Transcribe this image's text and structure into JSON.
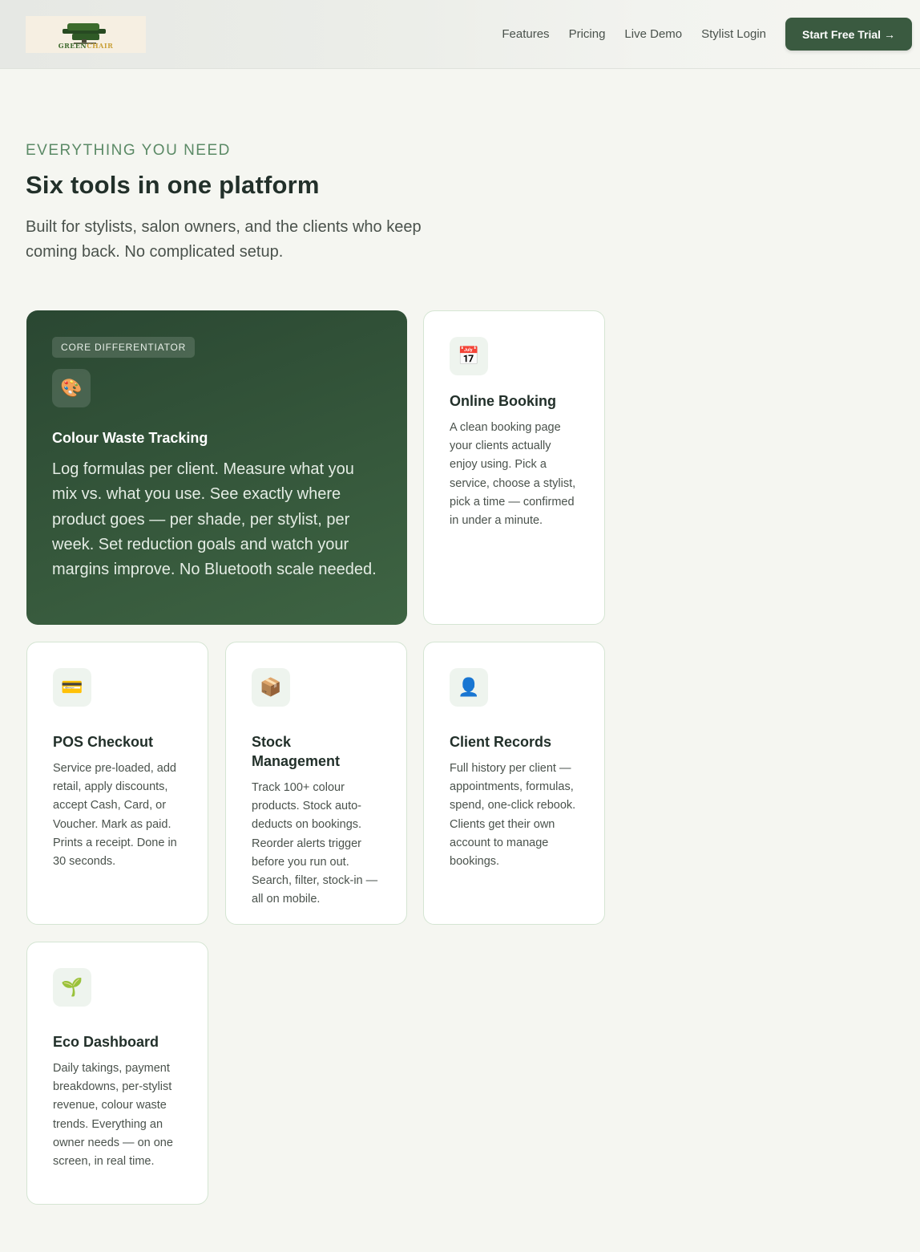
{
  "header": {
    "logo_text_main": "GREEN",
    "logo_text_accent": "CHAIR",
    "nav": [
      "Features",
      "Pricing",
      "Live Demo",
      "Stylist Login"
    ],
    "cta_label": "Start Free Trial →"
  },
  "intro": {
    "eyebrow": "EVERYTHING YOU NEED",
    "title": "Six tools in one platform",
    "subtitle": "Built for stylists, salon owners, and the clients who keep coming back. No complicated setup."
  },
  "featured": {
    "badge": "CORE DIFFERENTIATOR",
    "icon": "🎨",
    "icon_name": "palette-icon",
    "title": "Colour Waste Tracking",
    "description": "Log formulas per client. Measure what you mix vs. what you use. See exactly where product goes — per shade, per stylist, per week. Set reduction goals and watch your margins improve. No Bluetooth scale needed."
  },
  "cards": {
    "booking": {
      "icon": "📅",
      "icon_name": "calendar-icon",
      "title": "Online Booking",
      "description": "A clean booking page your clients actually enjoy using. Pick a service, choose a stylist, pick a time — confirmed in under a minute."
    },
    "pos": {
      "icon": "💳",
      "icon_name": "credit-card-icon",
      "title": "POS Checkout",
      "description": "Service pre-loaded, add retail, apply discounts, accept Cash, Card, or Voucher. Mark as paid. Prints a receipt. Done in 30 seconds."
    },
    "stock": {
      "icon": "📦",
      "icon_name": "package-icon",
      "title": "Stock Management",
      "description": "Track 100+ colour products. Stock auto-deducts on bookings. Reorder alerts trigger before you run out. Search, filter, stock-in — all on mobile."
    },
    "client": {
      "icon": "👤",
      "icon_name": "user-icon",
      "title": "Client Records",
      "description": "Full history per client — appointments, formulas, spend, one-click rebook. Clients get their own account to manage bookings."
    },
    "eco": {
      "icon": "🌱",
      "icon_name": "seedling-icon",
      "title": "Eco Dashboard",
      "description": "Daily takings, payment breakdowns, per-stylist revenue, colour waste trends. Everything an owner needs — on one screen, in real time."
    }
  },
  "colors": {
    "brand_green": "#3a5a40",
    "eyebrow_green": "#5b8a66",
    "background": "#f5f6f1"
  }
}
